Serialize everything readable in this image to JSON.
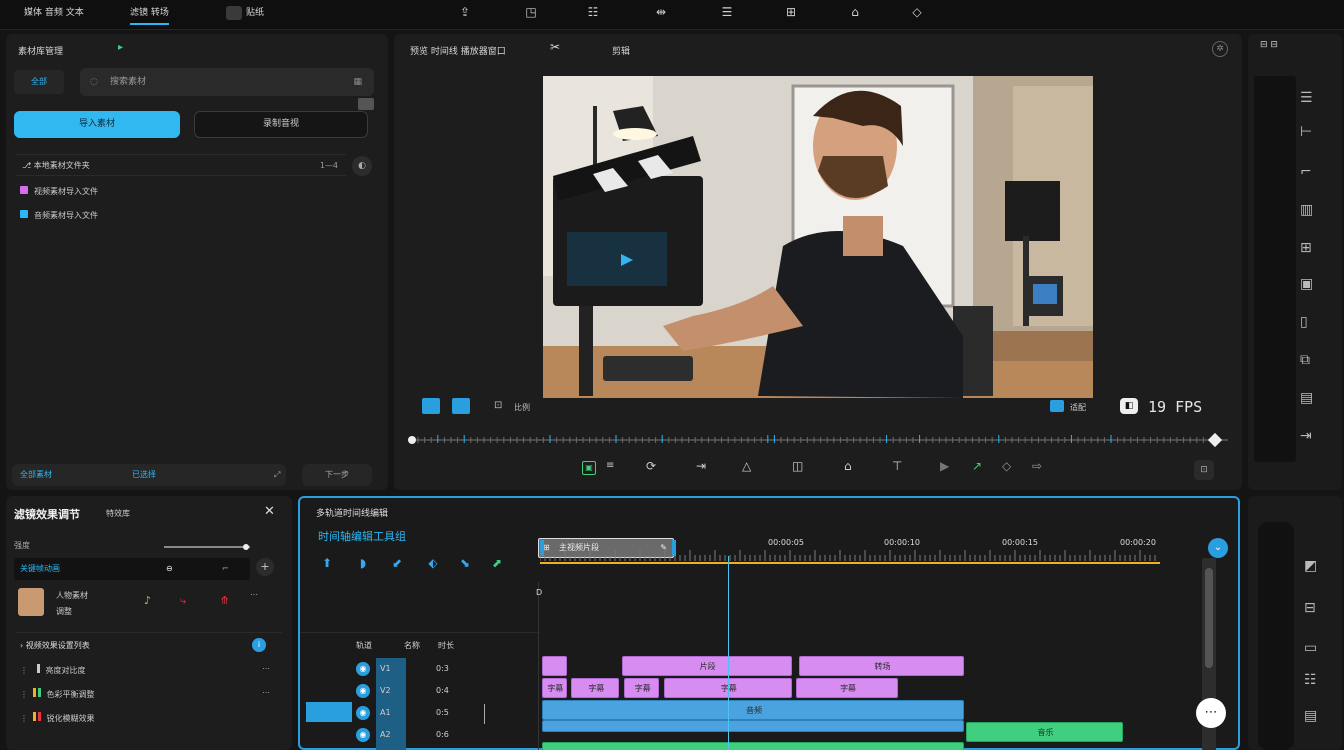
{
  "topbar": {
    "tabs": [
      {
        "label": "媒体 音频 文本"
      },
      {
        "label": "滤镜 转场"
      },
      {
        "label": "贴纸"
      }
    ],
    "tool_icons": [
      "export-icon",
      "crop-icon",
      "grid-icon",
      "split-icon",
      "list-icon",
      "layout-icon",
      "home-icon",
      "tag-icon"
    ]
  },
  "media": {
    "header": "素材库管理",
    "filter_chip": "全部",
    "search_placeholder": "搜索素材",
    "import_button": "导入素材",
    "record_button": "录制音视",
    "path_row": "本地素材文件夹",
    "path_count": "1—4",
    "list": [
      {
        "label": "视频素材导入文件",
        "color": "#d86cf0"
      },
      {
        "label": "音频素材导入文件",
        "color": "#2bb7f5"
      }
    ],
    "footer_left": "全部素材",
    "footer_mid": "已选择",
    "footer_btn": "下一步"
  },
  "preview": {
    "title": "预览 时间线 播放器窗口",
    "mode_label": "剪辑",
    "fps_text": "19 FPS",
    "fit_label": "适配",
    "left_label": "比例",
    "controls": [
      "mark-icon",
      "link-icon",
      "cut-icon",
      "shape-icon",
      "camera-icon",
      "crop-icon",
      "text-icon",
      "play-icon",
      "pen-icon",
      "diamond-icon",
      "forward-icon"
    ]
  },
  "effects": {
    "title": "滤镜效果调节",
    "subtitle": "特效库",
    "slider_label": "强度",
    "slider_value": 0.95,
    "row_label": "关键帧动画",
    "thumb_name": "人物素材",
    "thumb_sub": "调整",
    "section": "视频效果设置列表",
    "items": [
      {
        "label": "亮度对比度"
      },
      {
        "label": "色彩平衡调整"
      },
      {
        "label": "锐化模糊效果"
      }
    ]
  },
  "timeline": {
    "title": "多轨道时间线编辑",
    "subtitle": "时间轴编辑工具组",
    "clip_chip": "主视频片段",
    "ruler": [
      "00:00:05",
      "00:00:10",
      "00:00:15",
      "00:00:20"
    ],
    "track_headers": [
      "轨道",
      "名称",
      "时长"
    ],
    "tracks": [
      {
        "name": "V1",
        "dur": "0:3"
      },
      {
        "name": "V2",
        "dur": "0:4"
      },
      {
        "name": "A1",
        "dur": "0:5"
      },
      {
        "name": "A2",
        "dur": "0:6"
      }
    ],
    "pink_row1": [
      {
        "label": "",
        "start": 0,
        "end": 1
      },
      {
        "label": "片段",
        "start": 3,
        "end": 9.5
      },
      {
        "label": "转场",
        "start": 9.7,
        "end": 16
      }
    ],
    "pink_row2": [
      {
        "label": "字幕",
        "start": 0,
        "end": 1
      },
      {
        "label": "字幕",
        "start": 1.1,
        "end": 3
      },
      {
        "label": "字幕",
        "start": 3.1,
        "end": 4.5
      },
      {
        "label": "字幕",
        "start": 4.6,
        "end": 9.5
      },
      {
        "label": "字幕",
        "start": 9.6,
        "end": 13.5
      }
    ],
    "blue_row": [
      {
        "label": "音频",
        "start": 0,
        "end": 16
      }
    ],
    "green_row": [
      {
        "label": "音乐",
        "start": 16,
        "end": 22
      }
    ]
  },
  "colors": {
    "accent": "#2bb7f5",
    "pink": "#d68cf0",
    "blue": "#4aa3de",
    "green": "#3fcf7e"
  }
}
